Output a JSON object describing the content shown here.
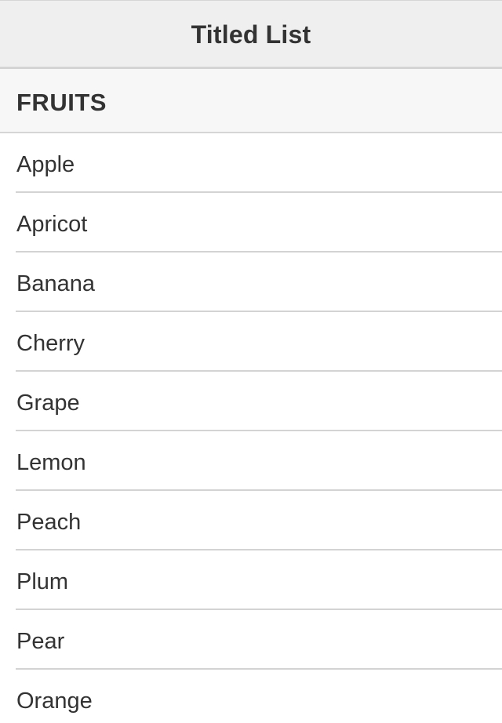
{
  "navbar": {
    "title": "Titled List"
  },
  "section": {
    "title": "FRUITS"
  },
  "items": [
    {
      "label": "Apple"
    },
    {
      "label": "Apricot"
    },
    {
      "label": "Banana"
    },
    {
      "label": "Cherry"
    },
    {
      "label": "Grape"
    },
    {
      "label": "Lemon"
    },
    {
      "label": "Peach"
    },
    {
      "label": "Plum"
    },
    {
      "label": "Pear"
    },
    {
      "label": "Orange"
    }
  ]
}
